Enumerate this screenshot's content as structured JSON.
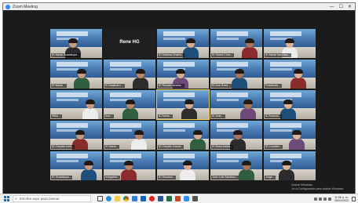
{
  "window": {
    "title": "Zoom Meeting",
    "controls": [
      "—",
      "☐",
      "✕"
    ]
  },
  "gallery": {
    "tiles": [
      {
        "name": "ID Maria Guadalupe..."
      },
      {
        "name": "",
        "display_name": "Rene HG"
      },
      {
        "name": "ID Dallana Chamu..."
      },
      {
        "name": "ID Gloria Chuc..."
      },
      {
        "name": "ID Maria Sanchez..."
      },
      {
        "name": "ID Maria ..."
      },
      {
        "name": "ID Alejandro ..."
      },
      {
        "name": "ID Rosario Avalos..."
      },
      {
        "name": "ID Ana Rosa ..."
      },
      {
        "name": "Rosalinda ..."
      },
      {
        "name": "Hilda ..."
      },
      {
        "name": "Ana ..."
      },
      {
        "name": "ID Adela..."
      },
      {
        "name": "ID Juan ..."
      },
      {
        "name": "ID Antonia..."
      },
      {
        "name": "ID Claudia Ivett..."
      },
      {
        "name": "ID Maria..."
      },
      {
        "name": "ID Claudio Garcia..."
      },
      {
        "name": "ID Rosa Adela..."
      },
      {
        "name": "ID Lourdes..."
      },
      {
        "name": "ID Guadalupe..."
      },
      {
        "name": "margarita..."
      },
      {
        "name": "ID Rosalva..."
      },
      {
        "name": "Jose Luis Sanchez..."
      },
      {
        "name": "Jorge..."
      }
    ]
  },
  "watermark": {
    "line1": "Activar Windows",
    "line2": "Ve a Configuración para activar Windows."
  },
  "taskbar": {
    "search_placeholder": "Escribe aquí para buscar",
    "clock_time": "11:06 a. m.",
    "clock_date": "26/01/2022"
  }
}
